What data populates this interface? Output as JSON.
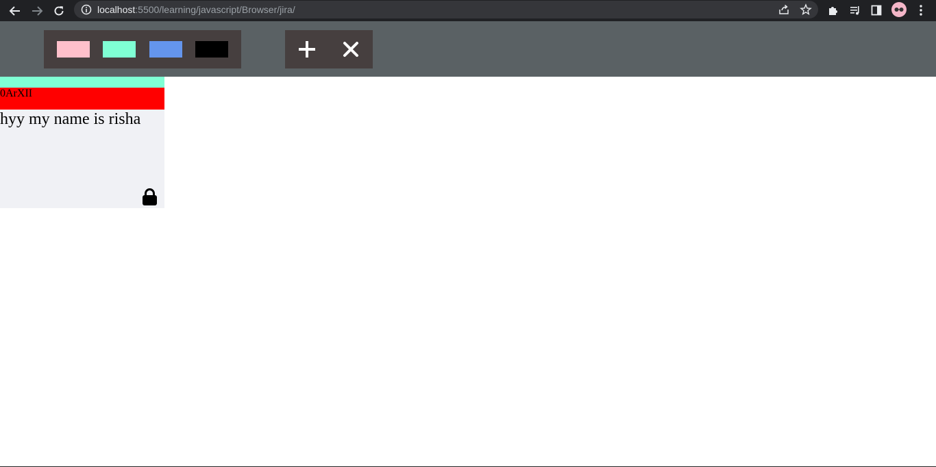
{
  "browser": {
    "url_host": "localhost",
    "url_path": ":5500/learning/javascript/Browser/jira/"
  },
  "toolbar": {
    "colors": [
      "#ffc0cb",
      "#7fffd4",
      "#6495ed",
      "#000000"
    ],
    "add_icon": "plus-icon",
    "remove_icon": "close-icon"
  },
  "ticket": {
    "color": "#7fffd4",
    "id": "0ArXII",
    "task": "hyy my name is risha",
    "lock_icon": "lock-icon"
  }
}
